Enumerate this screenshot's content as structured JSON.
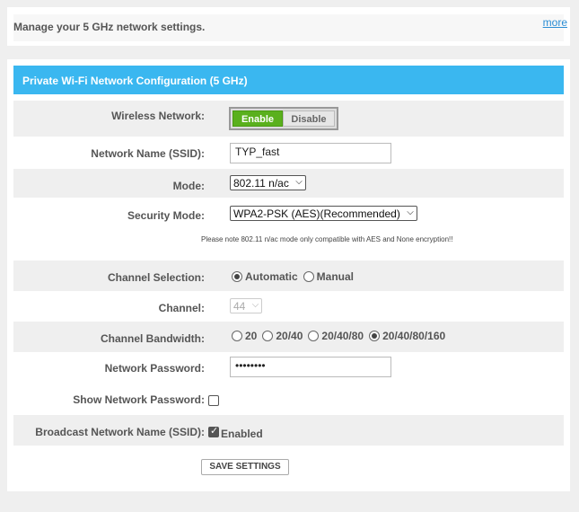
{
  "top": {
    "text": "Manage your 5 GHz network settings.",
    "more_label": "more"
  },
  "section": {
    "title": "Private Wi-Fi Network Configuration (5 GHz)"
  },
  "wireless": {
    "label": "Wireless Network:",
    "enable_label": "Enable",
    "disable_label": "Disable"
  },
  "ssid": {
    "label": "Network Name (SSID):",
    "value": "TYP_fast"
  },
  "mode": {
    "label": "Mode:",
    "value": "802.11 n/ac"
  },
  "security": {
    "label": "Security Mode:",
    "value": "WPA2-PSK (AES)(Recommended)",
    "note": "Please note 802.11 n/ac mode only compatible with AES and None encryption!!"
  },
  "channel_selection": {
    "label": "Channel Selection:",
    "options": [
      "Automatic",
      "Manual"
    ],
    "selected": "Automatic"
  },
  "channel": {
    "label": "Channel:",
    "value": "44"
  },
  "bandwidth": {
    "label": "Channel Bandwidth:",
    "options": [
      "20",
      "20/40",
      "20/40/80",
      "20/40/80/160"
    ],
    "selected": "20/40/80/160"
  },
  "password": {
    "label": "Network Password:",
    "value": "••••••••"
  },
  "show_password": {
    "label": "Show Network Password:"
  },
  "broadcast": {
    "label": "Broadcast Network Name (SSID):",
    "checkbox_label": "Enabled"
  },
  "save_label": "SAVE SETTINGS"
}
